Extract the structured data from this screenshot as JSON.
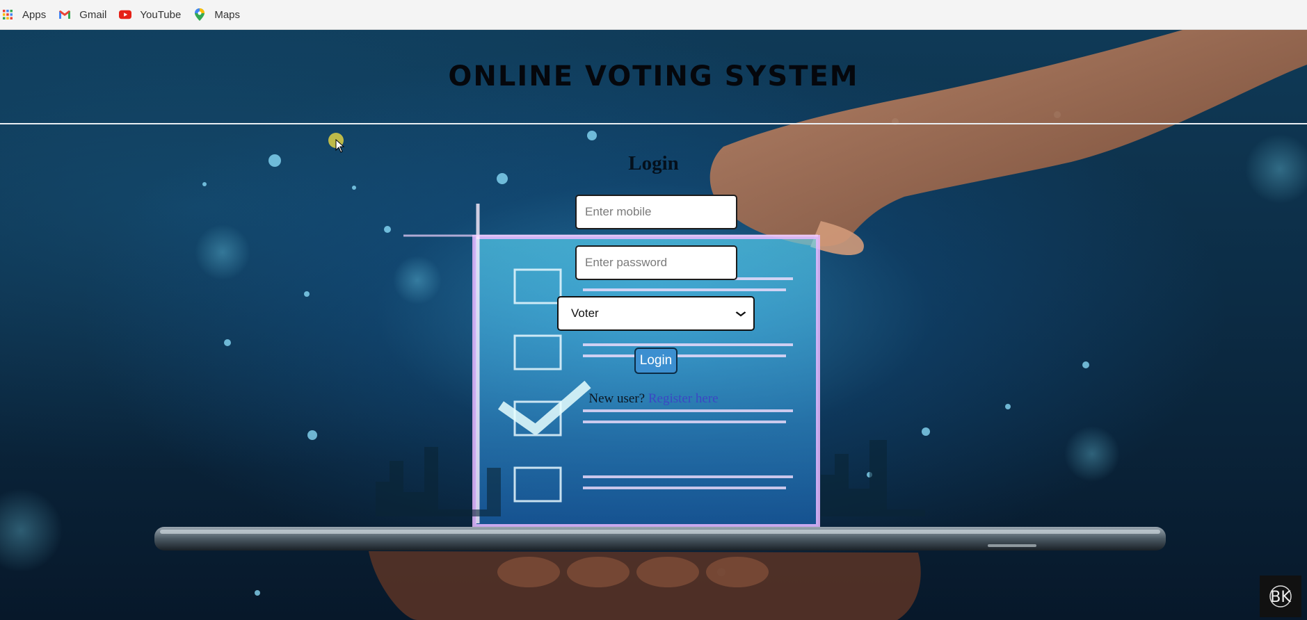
{
  "bookmarks": [
    {
      "label": "Apps",
      "icon": "apps-grid-icon"
    },
    {
      "label": "Gmail",
      "icon": "gmail-icon"
    },
    {
      "label": "YouTube",
      "icon": "youtube-icon"
    },
    {
      "label": "Maps",
      "icon": "maps-pin-icon"
    }
  ],
  "header": {
    "title": "ONLINE VOTING SYSTEM"
  },
  "login": {
    "title": "Login",
    "mobile_placeholder": "Enter mobile",
    "password_placeholder": "Enter password",
    "role_selected": "Voter",
    "button_label": "Login",
    "new_user_text": "New user?",
    "register_link": "Register here"
  },
  "watermark": {
    "text": "BK"
  },
  "colors": {
    "accent_button": "#3c8fd0",
    "link": "#3b48c4",
    "background": "#0f3a57"
  }
}
